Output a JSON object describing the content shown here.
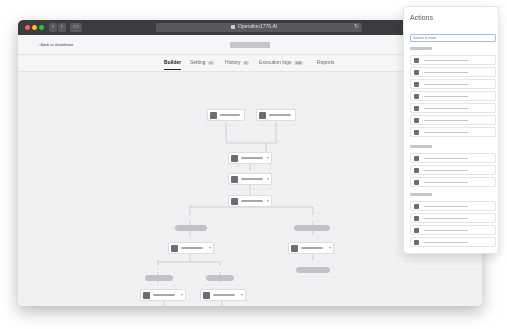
{
  "browser": {
    "url": "Operation1776.AI",
    "reload_icon": "↻",
    "back_icon": "‹",
    "forward_icon": "›",
    "sidebar_icon": "▭"
  },
  "header": {
    "back_label": "‹ Back to Workflows"
  },
  "tabs": [
    {
      "label": "Builder",
      "active": true,
      "badge": ""
    },
    {
      "label": "Setting",
      "active": false,
      "badge": "0"
    },
    {
      "label": "History",
      "active": false,
      "badge": "0"
    },
    {
      "label": "Execution logs",
      "active": false,
      "badge": "128"
    },
    {
      "label": "Reports",
      "active": false,
      "badge": ""
    }
  ],
  "actions_panel": {
    "title": "Actions",
    "search_placeholder": "Search & more"
  },
  "colors": {
    "accent": "#9fc3e6",
    "chrome": "#3a3c3f",
    "node_icon": "#6b6d70"
  }
}
